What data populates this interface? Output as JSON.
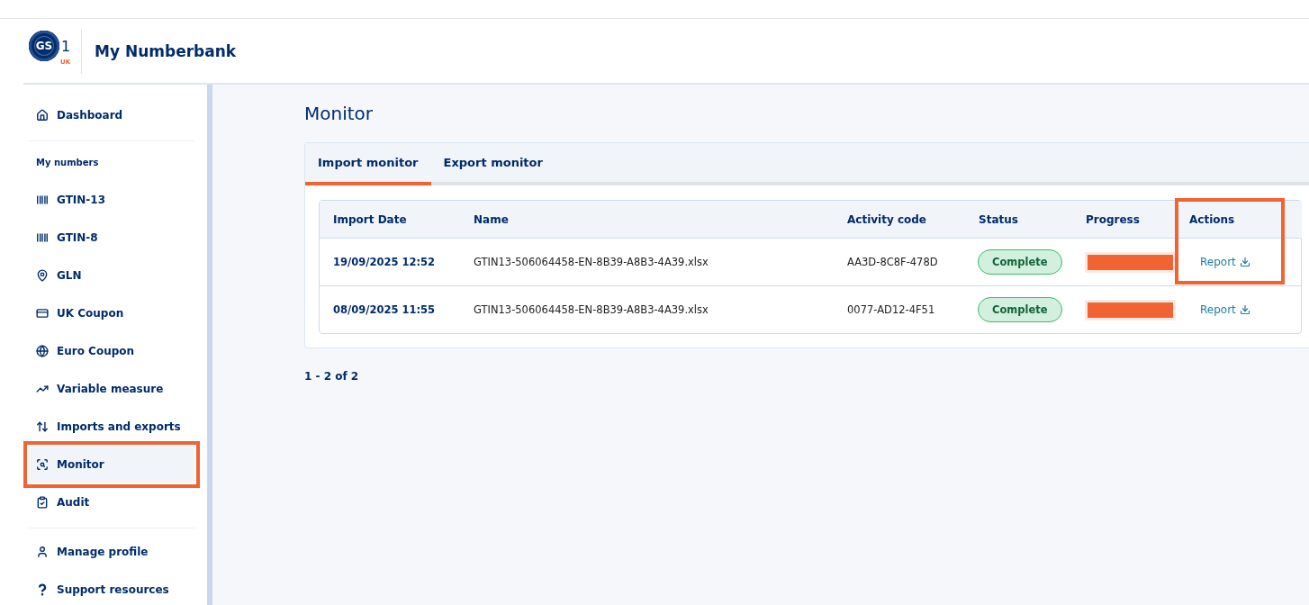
{
  "logo": {
    "letters": "GS",
    "digit": "1",
    "region": "UK"
  },
  "app_title": "My Numberbank",
  "sidebar": {
    "sections": [
      {
        "items": [
          {
            "label": "Dashboard",
            "selected": false,
            "highlighted": false
          }
        ]
      },
      {
        "heading": "My numbers",
        "items": [
          {
            "label": "GTIN-13",
            "selected": false,
            "highlighted": false
          },
          {
            "label": "GTIN-8",
            "selected": false,
            "highlighted": false
          },
          {
            "label": "GLN",
            "selected": false,
            "highlighted": false
          },
          {
            "label": "UK Coupon",
            "selected": false,
            "highlighted": false
          },
          {
            "label": "Euro Coupon",
            "selected": false,
            "highlighted": false
          },
          {
            "label": "Variable measure",
            "selected": false,
            "highlighted": false
          },
          {
            "label": "Imports and exports",
            "selected": false,
            "highlighted": false
          },
          {
            "label": "Monitor",
            "selected": true,
            "highlighted": true
          },
          {
            "label": "Audit",
            "selected": false,
            "highlighted": false
          }
        ]
      },
      {
        "items": [
          {
            "label": "Manage profile",
            "selected": false,
            "highlighted": false
          },
          {
            "label": "Support resources",
            "selected": false,
            "highlighted": false
          }
        ]
      }
    ]
  },
  "page_title": "Monitor",
  "tabs": [
    {
      "label": "Import monitor",
      "selected": true
    },
    {
      "label": "Export monitor",
      "selected": false
    }
  ],
  "table": {
    "columns": [
      {
        "label": "Import Date"
      },
      {
        "label": "Name"
      },
      {
        "label": "Activity code"
      },
      {
        "label": "Status"
      },
      {
        "label": "Progress"
      },
      {
        "label": "Actions",
        "highlighted": true
      }
    ],
    "rows": [
      {
        "date": "19/09/2025 12:52",
        "name": "GTIN13-506064458-EN-8B39-A8B3-4A39.xlsx",
        "activity_code": "AA3D-8C8F-478D",
        "status": "Complete",
        "level": 1,
        "action": "Report"
      },
      {
        "date": "08/09/2025 11:55",
        "name": "GTIN13-506064458-EN-8B39-A8B3-4A39.xlsx",
        "activity_code": "0077-AD12-4F51",
        "status": "Complete",
        "level": 1,
        "action": "Report"
      }
    ]
  },
  "pagination": "1 - 2 of 2"
}
